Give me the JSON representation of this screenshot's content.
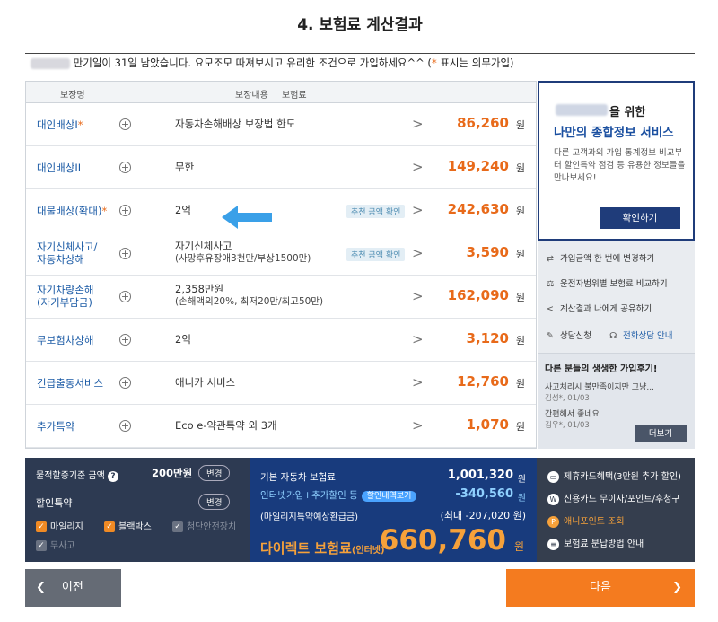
{
  "page": {
    "title": "4. 보험료 계산결과"
  },
  "notice": {
    "text": "만기일이 31일 남았습니다. 요모조모 따져보시고 유리한 조건으로 가입하세요^^ (",
    "star": "*",
    "suffix": " 표시는 의무가입)"
  },
  "table": {
    "headers": [
      "보장명",
      "보장내용",
      "보험료"
    ],
    "rows": [
      {
        "name": "대인배상I",
        "required": "*",
        "coverage": "자동차손해배상 보장법 한도",
        "coverage2": "",
        "tag": "",
        "amount": "86,260",
        "unit": "원"
      },
      {
        "name": "대인배상II",
        "required": "",
        "coverage": "무한",
        "coverage2": "",
        "tag": "",
        "amount": "149,240",
        "unit": "원"
      },
      {
        "name": "대물배상(확대)",
        "required": "*",
        "coverage": "2억",
        "coverage2": "",
        "tag": "추천 금액 확인",
        "amount": "242,630",
        "unit": "원"
      },
      {
        "name": "자기신체사고/",
        "name2": "자동차상해",
        "required": "",
        "coverage": "자기신체사고",
        "coverage2": "(사망후유장애3천만/부상1500만)",
        "tag": "추천 금액 확인",
        "amount": "3,590",
        "unit": "원"
      },
      {
        "name": "자기차량손해",
        "name2": "(자기부담금)",
        "required": "",
        "coverage": "2,358만원",
        "coverage2": "(손해액의20%, 최저20만/최고50만)",
        "tag": "",
        "amount": "162,090",
        "unit": "원"
      },
      {
        "name": "무보험차상해",
        "required": "",
        "coverage": "2억",
        "coverage2": "",
        "tag": "",
        "amount": "3,120",
        "unit": "원"
      },
      {
        "name": "긴급출동서비스",
        "required": "",
        "coverage": "애니카 서비스",
        "coverage2": "",
        "tag": "",
        "amount": "12,760",
        "unit": "원"
      },
      {
        "name": "추가특약",
        "required": "",
        "coverage": "Eco e-약관특약 외 3개",
        "coverage2": "",
        "tag": "",
        "amount": "1,070",
        "unit": "원"
      }
    ]
  },
  "side": {
    "line1": "을 위한",
    "line2": "나만의 종합정보 서비스",
    "desc": "다른 고객과의 가입 통계정보 비교부터 할인특약 점검 등 유용한 정보들을 만나보세요!",
    "confirm": "확인하기",
    "links": [
      "가입금액 한 번에 변경하기",
      "운전자범위별 보험료 비교하기",
      "계산결과 나에게 공유하기",
      "상담신청",
      "전화상담 안내"
    ],
    "reviews_title": "다른 분들의 생생한 가입후기!",
    "reviews": [
      {
        "text": "사고처리시 불만족이지만 그냥...",
        "meta": "김성*, 01/03"
      },
      {
        "text": "간편해서 좋네요",
        "meta": "김우*, 01/03"
      }
    ],
    "more": "더보기"
  },
  "bottom": {
    "physical_label": "물적할증기준 금액",
    "physical_value": "200만원",
    "change": "변경",
    "discount_label": "할인특약",
    "checks": [
      "마일리지",
      "블랙박스",
      "첨단안전장치",
      "무사고"
    ],
    "base_label": "기본 자동차 보험료",
    "base_value": "1,001,320",
    "discount_line": "인터넷가입+추가할인 등",
    "discount_badge": "할인내역보기",
    "discount_value": "-340,560",
    "mileage_label": "(마일리지특약예상환급금)",
    "mileage_value": "(최대 -207,020 원)",
    "final_label": "다이렉트 보험료",
    "final_sub": "(인터넷)",
    "final_value": "660,760",
    "won": "원",
    "benefits": [
      "제휴카드혜택(3만원 추가 할인)",
      "신용카드 무이자/포인트/후청구",
      "애니포인트 조회",
      "보험료 분납방법 안내"
    ]
  },
  "nav": {
    "prev": "이전",
    "next": "다음"
  }
}
